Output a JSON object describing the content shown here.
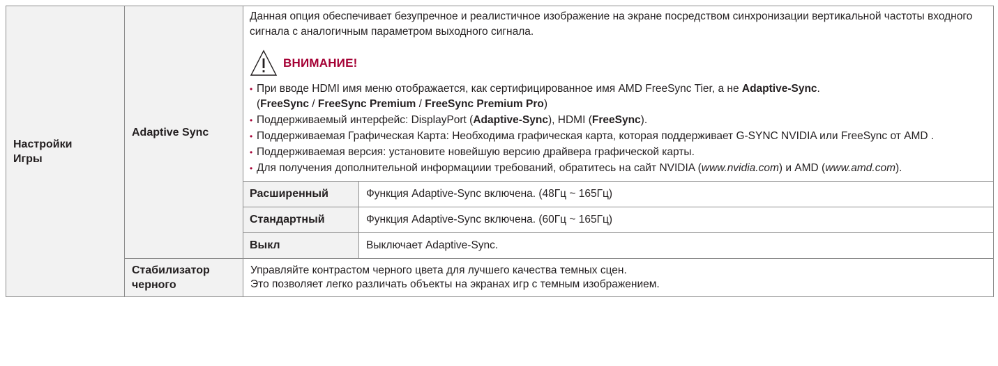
{
  "category": {
    "line1": "Настройки",
    "line2": "Игры"
  },
  "adaptive_sync": {
    "label": "Adaptive Sync",
    "description": "Данная опция обеспечивает безупречное и реалистичное изображение на экране посредством синхронизации вертикальной частоты входного сигнала с аналогичным параметром выходного сигнала.",
    "caution_label": "ВНИМАНИЕ!",
    "notes": {
      "n1_text": "При вводе HDMI имя меню отображается, как сертифицированное имя AMD FreeSync Tier, а не ",
      "n1_bold": "Adaptive-Sync",
      "n1_end": ".",
      "n1_open": "(",
      "n1_fs": "FreeSync",
      "n1_sep1": " / ",
      "n1_fsp": "FreeSync Premium",
      "n1_sep2": " / ",
      "n1_fspp": "FreeSync Premium Pro",
      "n1_close": ")",
      "n2_text": "Поддерживаемый интерфейс: DisplayPort (",
      "n2_bold1": "Adaptive-Sync",
      "n2_mid": "), HDMI (",
      "n2_bold2": "FreeSync",
      "n2_end": ").",
      "n3_text": "Поддерживаемая Графическая Карта: Необходима графическая карта, которая поддерживает G-SYNC NVIDIA или FreeSync от AMD .",
      "n4_text": "Поддерживаемая версия: установите новейшую версию драйвера графической карты.",
      "n5_text": "Для получения дополнительной информациии требований, обратитесь на сайт NVIDIA (",
      "n5_link1": "www.nvidia.com",
      "n5_mid": ") и AMD (",
      "n5_link2": "www.amd.com",
      "n5_end": ")."
    },
    "modes": [
      {
        "label": "Расширенный",
        "text": "Функция Adaptive-Sync включена. (48Гц ~ 165Гц)"
      },
      {
        "label": "Стандартный",
        "text": "Функция Adaptive-Sync включена. (60Гц ~ 165Гц)"
      },
      {
        "label": "Выкл",
        "text": "Выключает Adaptive-Sync."
      }
    ]
  },
  "black_stabilizer": {
    "label_line1": "Стабилизатор",
    "label_line2": "черного",
    "text_line1": "Управляйте контрастом черного цвета для лучшего качества темных сцен.",
    "text_line2": "Это позволяет легко различать объекты на экранах игр с темным изображением."
  },
  "colors": {
    "accent": "#a50034",
    "header_bg": "#f2f2f2",
    "border": "#8c8c8c"
  },
  "icons": {
    "caution": "warning-triangle-icon"
  }
}
